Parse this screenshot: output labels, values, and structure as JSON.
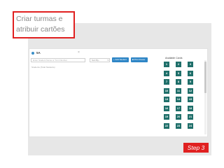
{
  "slide": {
    "title_line1": "Criar turmas e",
    "title_line2": "atribuir cartões",
    "step_label": "Step 3",
    "accent_color": "#e02020"
  },
  "app": {
    "class_name": "5A",
    "close_symbol": "×",
    "search_placeholder": "Enter Student Name or Turn Number",
    "sort_label": "Sort By...",
    "sort_caret": "▾",
    "add_button_label": "+ Add Student",
    "print_button_label": "■ Print Roster",
    "students_title": "Students (Total Students)",
    "cards_title": "Available Cards",
    "button_color": "#2f86c6",
    "card_color": "#1f6f6a",
    "cards": [
      "1",
      "2",
      "3",
      "4",
      "5",
      "6",
      "7",
      "8",
      "9",
      "10",
      "11",
      "12",
      "13",
      "14",
      "15",
      "16",
      "17",
      "18",
      "19",
      "20",
      "21",
      "22",
      "23",
      "24"
    ]
  }
}
